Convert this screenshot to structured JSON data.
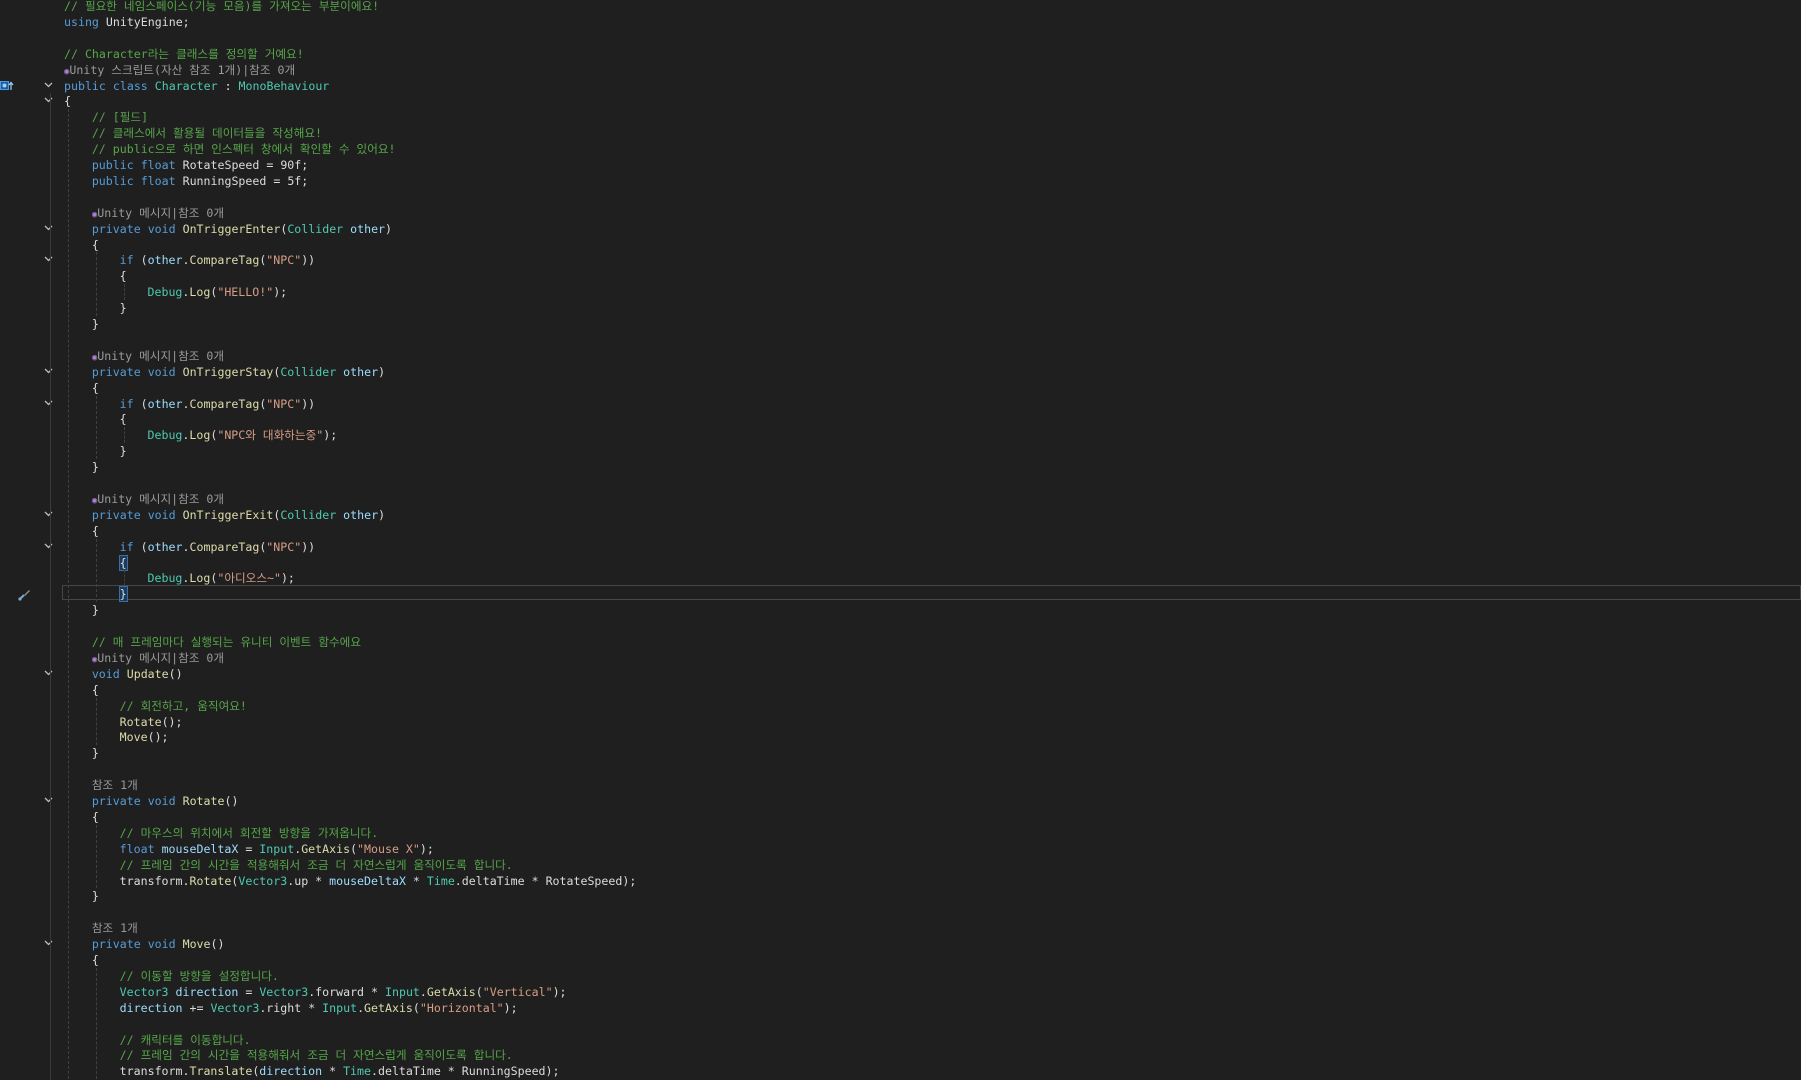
{
  "editor": {
    "language": "C#",
    "colors": {
      "background": "#1f1f1f",
      "comment": "#57a64a",
      "keyword": "#569cd6",
      "type": "#4ec9b0",
      "method": "#dcdcaa",
      "string": "#d69d85",
      "plain": "#dcdcdc",
      "codelens": "#9a9a9a"
    },
    "lines": [
      {
        "text": "// 필요한 네임스페이스(기능 모음)를 가져오는 부분이에요!"
      },
      {
        "text": "using UnityEngine;"
      },
      {
        "text": ""
      },
      {
        "text": "// Character라는 클래스를 정의할 거예요!"
      },
      {
        "text": "Unity 스크립트(자산 참조 1개)|참조 0개"
      },
      {
        "text": "public class Character : MonoBehaviour"
      },
      {
        "text": "{"
      },
      {
        "text": "// [필드]"
      },
      {
        "text": "// 클래스에서 활용될 데이터들을 작성해요!"
      },
      {
        "text": "// public으로 하면 인스펙터 창에서 확인할 수 있어요!"
      },
      {
        "text": "public float RotateSpeed = 90f;"
      },
      {
        "text": "public float RunningSpeed = 5f;"
      },
      {
        "text": ""
      },
      {
        "text": "Unity 메시지|참조 0개"
      },
      {
        "text": "private void OnTriggerEnter(Collider other)"
      },
      {
        "text": "{"
      },
      {
        "text": "if (other.CompareTag(\"NPC\"))"
      },
      {
        "text": "{"
      },
      {
        "text": "Debug.Log(\"HELLO!\");"
      },
      {
        "text": "}"
      },
      {
        "text": "}"
      },
      {
        "text": ""
      },
      {
        "text": "Unity 메시지|참조 0개"
      },
      {
        "text": "private void OnTriggerStay(Collider other)"
      },
      {
        "text": "{"
      },
      {
        "text": "if (other.CompareTag(\"NPC\"))"
      },
      {
        "text": "{"
      },
      {
        "text": "Debug.Log(\"NPC와 대화하는중\");"
      },
      {
        "text": "}"
      },
      {
        "text": "}"
      },
      {
        "text": ""
      },
      {
        "text": "Unity 메시지|참조 0개"
      },
      {
        "text": "private void OnTriggerExit(Collider other)"
      },
      {
        "text": "{"
      },
      {
        "text": "if (other.CompareTag(\"NPC\"))"
      },
      {
        "text": "{"
      },
      {
        "text": "Debug.Log(\"아디오스~\");"
      },
      {
        "text": "}"
      },
      {
        "text": "}"
      },
      {
        "text": ""
      },
      {
        "text": "// 매 프레임마다 실행되는 유니티 이벤트 함수에요"
      },
      {
        "text": "Unity 메시지|참조 0개"
      },
      {
        "text": "void Update()"
      },
      {
        "text": "{"
      },
      {
        "text": "// 회전하고, 움직여요!"
      },
      {
        "text": "Rotate();"
      },
      {
        "text": "Move();"
      },
      {
        "text": "}"
      },
      {
        "text": ""
      },
      {
        "text": "참조 1개"
      },
      {
        "text": "private void Rotate()"
      },
      {
        "text": "{"
      },
      {
        "text": "// 마우스의 위치에서 회전할 방향을 가져옵니다."
      },
      {
        "text": "float mouseDeltaX = Input.GetAxis(\"Mouse X\");"
      },
      {
        "text": "// 프레임 간의 시간을 적용해줘서 조금 더 자연스럽게 움직이도록 합니다."
      },
      {
        "text": "transform.Rotate(Vector3.up * mouseDeltaX * Time.deltaTime * RotateSpeed);"
      },
      {
        "text": "}"
      },
      {
        "text": ""
      },
      {
        "text": "참조 1개"
      },
      {
        "text": "private void Move()"
      },
      {
        "text": "{"
      },
      {
        "text": "// 이동할 방향을 설정합니다."
      },
      {
        "text": "Vector3 direction = Vector3.forward * Input.GetAxis(\"Vertical\");"
      },
      {
        "text": "direction += Vector3.right * Input.GetAxis(\"Horizontal\");"
      },
      {
        "text": ""
      },
      {
        "text": "// 캐릭터를 이동합니다."
      },
      {
        "text": "// 프레임 간의 시간을 적용해줘서 조금 더 자연스럽게 움직이도록 합니다."
      },
      {
        "text": "transform.Translate(direction * Time.deltaTime * RunningSpeed);"
      }
    ]
  }
}
